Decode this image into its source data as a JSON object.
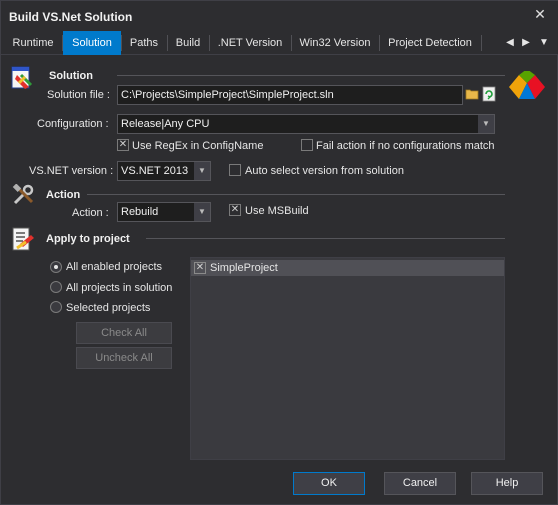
{
  "window": {
    "title": "Build VS.Net Solution",
    "close_glyph": "✕"
  },
  "tabs": [
    {
      "label": "Runtime"
    },
    {
      "label": "Solution",
      "active": true
    },
    {
      "label": "Paths"
    },
    {
      "label": "Build"
    },
    {
      "label": ".NET Version"
    },
    {
      "label": "Win32 Version"
    },
    {
      "label": "Project Detection"
    }
  ],
  "tab_nav": {
    "prev": "◀",
    "next": "▶",
    "menu": "▼"
  },
  "solution": {
    "section_title": "Solution",
    "file_label": "Solution file :",
    "file_value": "C:\\Projects\\SimpleProject\\SimpleProject.sln",
    "config_label": "Configuration :",
    "config_value": "Release|Any CPU",
    "use_regex_label": "Use RegEx in ConfigName",
    "use_regex_checked": true,
    "fail_action_label": "Fail action if no configurations match",
    "fail_action_checked": false,
    "vsnet_label": "VS.NET version :",
    "vsnet_value": "VS.NET 2013",
    "auto_select_label": "Auto select version from solution",
    "auto_select_checked": false
  },
  "action": {
    "section_title": "Action",
    "action_label": "Action :",
    "action_value": "Rebuild",
    "msbuild_label": "Use MSBuild",
    "msbuild_checked": true
  },
  "apply": {
    "section_title": "Apply to project",
    "options": [
      {
        "label": "All enabled projects",
        "checked": true
      },
      {
        "label": "All projects in solution",
        "checked": false
      },
      {
        "label": "Selected projects",
        "checked": false
      }
    ],
    "check_all_label": "Check All",
    "uncheck_all_label": "Uncheck All",
    "projects": [
      {
        "name": "SimpleProject",
        "checked": true
      }
    ]
  },
  "buttons": {
    "ok": "OK",
    "cancel": "Cancel",
    "help": "Help"
  },
  "colors": {
    "accent": "#007acc",
    "background": "#2d2d30"
  }
}
